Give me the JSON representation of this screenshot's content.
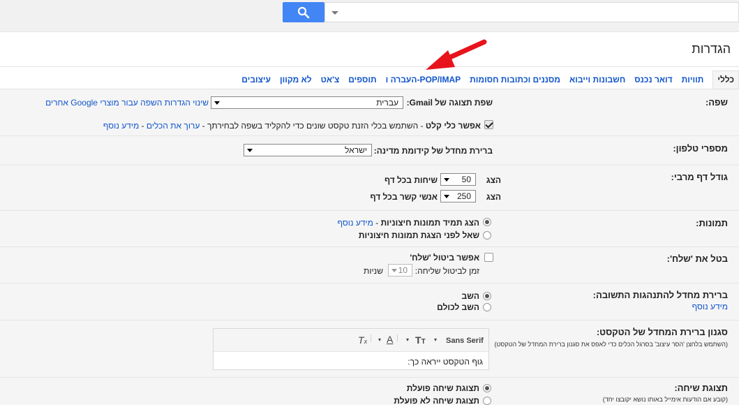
{
  "search": {
    "placeholder": "",
    "value": ""
  },
  "page": {
    "title": "הגדרות"
  },
  "tabs": [
    {
      "label": "כללי",
      "active": true
    },
    {
      "label": "תוויות"
    },
    {
      "label": "דואר נכנס"
    },
    {
      "label": "חשבונות וייבוא"
    },
    {
      "label": "מסננים וכתובות חסומות"
    },
    {
      "label": "העברה ו-POP/IMAP"
    },
    {
      "label": "תוספים"
    },
    {
      "label": "צ'אט"
    },
    {
      "label": "לא מקוון"
    },
    {
      "label": "עיצובים"
    }
  ],
  "language": {
    "label": "שפה:",
    "display_label": "שפת תצוגה של Gmail:",
    "selected": "עברית",
    "change_link": "שינוי הגדרות השפה עבור מוצרי Google אחרים",
    "input_tools_enable": "אפשר כלי קלט",
    "input_tools_desc": " - השתמש בכלי הזנת טקסט שונים כדי להקליד בשפה לבחירתך - ",
    "edit_tools_link": "ערוך את הכלים",
    "sep": " - ",
    "learn_more": "מידע נוסף"
  },
  "phone": {
    "label": "מספרי טלפון:",
    "country_label": "ברירת מחדל של קידומת מדינה:",
    "selected": "ישראל"
  },
  "page_size": {
    "label": "גודל דף מרבי:",
    "show1": "הצג",
    "conv_value": "50",
    "conv_suffix": "שיחות בכל דף",
    "show2": "הצג",
    "contacts_value": "250",
    "contacts_suffix": "אנשי קשר בכל דף"
  },
  "images": {
    "label": "תמונות:",
    "always_show": "הצג תמיד תמונות חיצוניות",
    "dash": " - ",
    "learn_more": "מידע נוסף",
    "ask_before": "שאל לפני הצגת תמונות חיצוניות"
  },
  "undo_send": {
    "label": "בטל את 'שלח':",
    "enable": "אפשר ביטול 'שלח'",
    "period_label": "זמן לביטול שליחה:",
    "period_value": "10",
    "seconds": "שניות"
  },
  "reply": {
    "label": "ברירת מחדל להתנהגות התשובה:",
    "learn_more": "מידע נוסף",
    "reply": "השב",
    "reply_all": "השב לכולם"
  },
  "text_style": {
    "label": "סגנון ברירת המחדל של הטקסט:",
    "note": "(השתמש בלחצן 'הסר עיצוב' בסרגל הכלים כדי לאפס את סגנון ברירת המחדל של הטקסט)",
    "font": "Sans Serif",
    "preview": "גוף הטקסט ייראה כך:"
  },
  "conversation": {
    "label": "תצוגת שיחה:",
    "note": "(קובע אם הודעות אימייל באותו נושא יקובצו יחד)",
    "on": "תצוגת שיחה פועלת",
    "off": "תצוגת שיחה לא פועלת"
  },
  "annotation_color": "#e8141c"
}
